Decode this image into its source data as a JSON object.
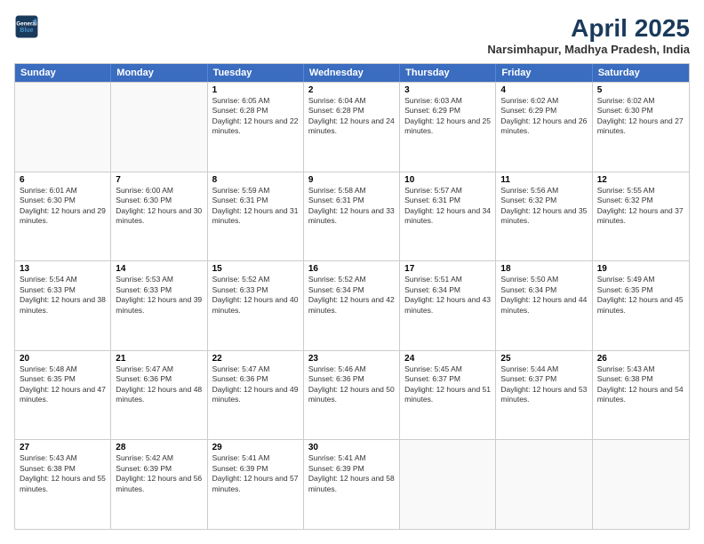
{
  "logo": {
    "line1": "General",
    "line2": "Blue"
  },
  "title": "April 2025",
  "location": "Narsimhapur, Madhya Pradesh, India",
  "days_of_week": [
    "Sunday",
    "Monday",
    "Tuesday",
    "Wednesday",
    "Thursday",
    "Friday",
    "Saturday"
  ],
  "weeks": [
    [
      {
        "day": "",
        "sunrise": "",
        "sunset": "",
        "daylight": ""
      },
      {
        "day": "",
        "sunrise": "",
        "sunset": "",
        "daylight": ""
      },
      {
        "day": "1",
        "sunrise": "Sunrise: 6:05 AM",
        "sunset": "Sunset: 6:28 PM",
        "daylight": "Daylight: 12 hours and 22 minutes."
      },
      {
        "day": "2",
        "sunrise": "Sunrise: 6:04 AM",
        "sunset": "Sunset: 6:28 PM",
        "daylight": "Daylight: 12 hours and 24 minutes."
      },
      {
        "day": "3",
        "sunrise": "Sunrise: 6:03 AM",
        "sunset": "Sunset: 6:29 PM",
        "daylight": "Daylight: 12 hours and 25 minutes."
      },
      {
        "day": "4",
        "sunrise": "Sunrise: 6:02 AM",
        "sunset": "Sunset: 6:29 PM",
        "daylight": "Daylight: 12 hours and 26 minutes."
      },
      {
        "day": "5",
        "sunrise": "Sunrise: 6:02 AM",
        "sunset": "Sunset: 6:30 PM",
        "daylight": "Daylight: 12 hours and 27 minutes."
      }
    ],
    [
      {
        "day": "6",
        "sunrise": "Sunrise: 6:01 AM",
        "sunset": "Sunset: 6:30 PM",
        "daylight": "Daylight: 12 hours and 29 minutes."
      },
      {
        "day": "7",
        "sunrise": "Sunrise: 6:00 AM",
        "sunset": "Sunset: 6:30 PM",
        "daylight": "Daylight: 12 hours and 30 minutes."
      },
      {
        "day": "8",
        "sunrise": "Sunrise: 5:59 AM",
        "sunset": "Sunset: 6:31 PM",
        "daylight": "Daylight: 12 hours and 31 minutes."
      },
      {
        "day": "9",
        "sunrise": "Sunrise: 5:58 AM",
        "sunset": "Sunset: 6:31 PM",
        "daylight": "Daylight: 12 hours and 33 minutes."
      },
      {
        "day": "10",
        "sunrise": "Sunrise: 5:57 AM",
        "sunset": "Sunset: 6:31 PM",
        "daylight": "Daylight: 12 hours and 34 minutes."
      },
      {
        "day": "11",
        "sunrise": "Sunrise: 5:56 AM",
        "sunset": "Sunset: 6:32 PM",
        "daylight": "Daylight: 12 hours and 35 minutes."
      },
      {
        "day": "12",
        "sunrise": "Sunrise: 5:55 AM",
        "sunset": "Sunset: 6:32 PM",
        "daylight": "Daylight: 12 hours and 37 minutes."
      }
    ],
    [
      {
        "day": "13",
        "sunrise": "Sunrise: 5:54 AM",
        "sunset": "Sunset: 6:33 PM",
        "daylight": "Daylight: 12 hours and 38 minutes."
      },
      {
        "day": "14",
        "sunrise": "Sunrise: 5:53 AM",
        "sunset": "Sunset: 6:33 PM",
        "daylight": "Daylight: 12 hours and 39 minutes."
      },
      {
        "day": "15",
        "sunrise": "Sunrise: 5:52 AM",
        "sunset": "Sunset: 6:33 PM",
        "daylight": "Daylight: 12 hours and 40 minutes."
      },
      {
        "day": "16",
        "sunrise": "Sunrise: 5:52 AM",
        "sunset": "Sunset: 6:34 PM",
        "daylight": "Daylight: 12 hours and 42 minutes."
      },
      {
        "day": "17",
        "sunrise": "Sunrise: 5:51 AM",
        "sunset": "Sunset: 6:34 PM",
        "daylight": "Daylight: 12 hours and 43 minutes."
      },
      {
        "day": "18",
        "sunrise": "Sunrise: 5:50 AM",
        "sunset": "Sunset: 6:34 PM",
        "daylight": "Daylight: 12 hours and 44 minutes."
      },
      {
        "day": "19",
        "sunrise": "Sunrise: 5:49 AM",
        "sunset": "Sunset: 6:35 PM",
        "daylight": "Daylight: 12 hours and 45 minutes."
      }
    ],
    [
      {
        "day": "20",
        "sunrise": "Sunrise: 5:48 AM",
        "sunset": "Sunset: 6:35 PM",
        "daylight": "Daylight: 12 hours and 47 minutes."
      },
      {
        "day": "21",
        "sunrise": "Sunrise: 5:47 AM",
        "sunset": "Sunset: 6:36 PM",
        "daylight": "Daylight: 12 hours and 48 minutes."
      },
      {
        "day": "22",
        "sunrise": "Sunrise: 5:47 AM",
        "sunset": "Sunset: 6:36 PM",
        "daylight": "Daylight: 12 hours and 49 minutes."
      },
      {
        "day": "23",
        "sunrise": "Sunrise: 5:46 AM",
        "sunset": "Sunset: 6:36 PM",
        "daylight": "Daylight: 12 hours and 50 minutes."
      },
      {
        "day": "24",
        "sunrise": "Sunrise: 5:45 AM",
        "sunset": "Sunset: 6:37 PM",
        "daylight": "Daylight: 12 hours and 51 minutes."
      },
      {
        "day": "25",
        "sunrise": "Sunrise: 5:44 AM",
        "sunset": "Sunset: 6:37 PM",
        "daylight": "Daylight: 12 hours and 53 minutes."
      },
      {
        "day": "26",
        "sunrise": "Sunrise: 5:43 AM",
        "sunset": "Sunset: 6:38 PM",
        "daylight": "Daylight: 12 hours and 54 minutes."
      }
    ],
    [
      {
        "day": "27",
        "sunrise": "Sunrise: 5:43 AM",
        "sunset": "Sunset: 6:38 PM",
        "daylight": "Daylight: 12 hours and 55 minutes."
      },
      {
        "day": "28",
        "sunrise": "Sunrise: 5:42 AM",
        "sunset": "Sunset: 6:39 PM",
        "daylight": "Daylight: 12 hours and 56 minutes."
      },
      {
        "day": "29",
        "sunrise": "Sunrise: 5:41 AM",
        "sunset": "Sunset: 6:39 PM",
        "daylight": "Daylight: 12 hours and 57 minutes."
      },
      {
        "day": "30",
        "sunrise": "Sunrise: 5:41 AM",
        "sunset": "Sunset: 6:39 PM",
        "daylight": "Daylight: 12 hours and 58 minutes."
      },
      {
        "day": "",
        "sunrise": "",
        "sunset": "",
        "daylight": ""
      },
      {
        "day": "",
        "sunrise": "",
        "sunset": "",
        "daylight": ""
      },
      {
        "day": "",
        "sunrise": "",
        "sunset": "",
        "daylight": ""
      }
    ]
  ]
}
